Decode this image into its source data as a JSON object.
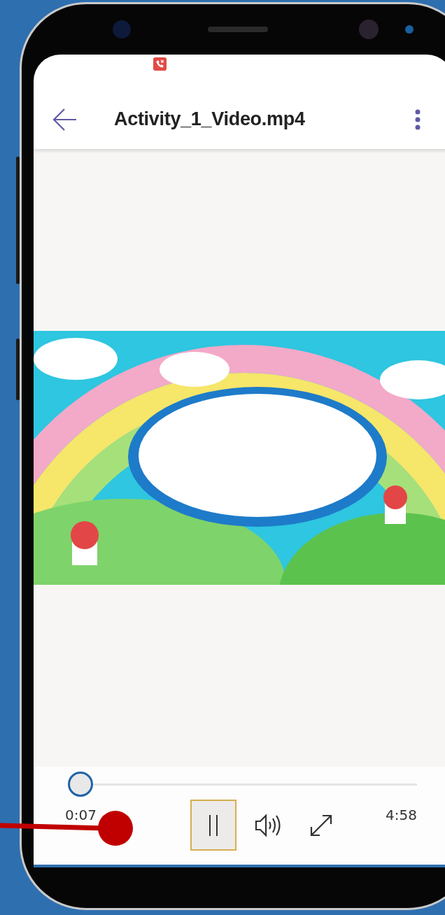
{
  "app_bar": {
    "title": "Activity_1_Video.mp4"
  },
  "player": {
    "level": 0.02,
    "elapsed": "0:07",
    "duration": "4:58",
    "playing": true
  }
}
